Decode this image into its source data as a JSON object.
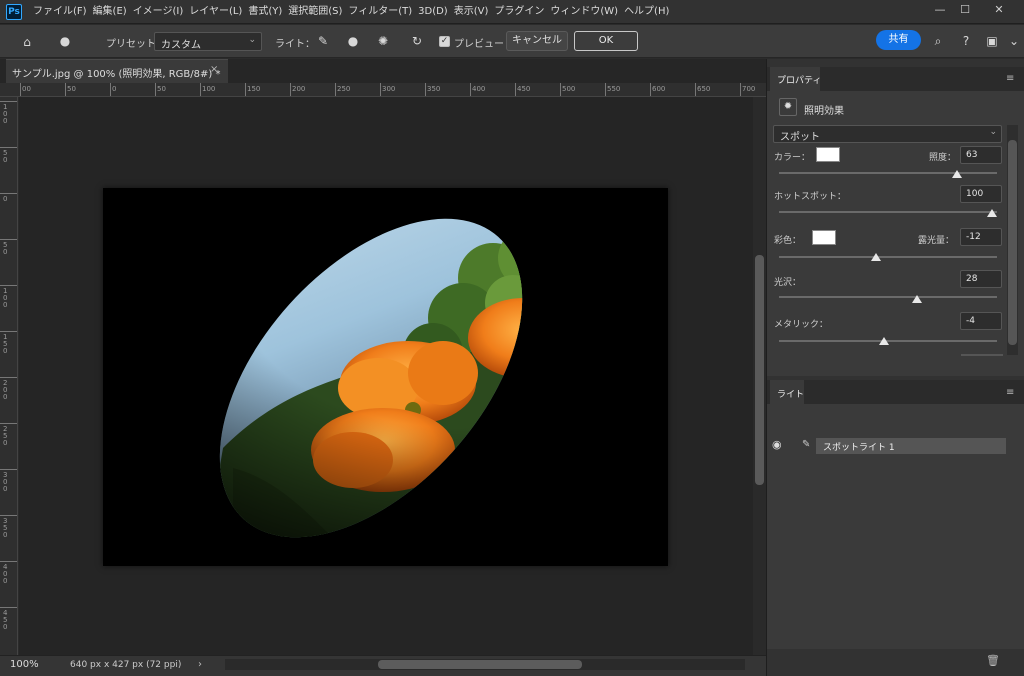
{
  "app": {
    "logo": "Ps"
  },
  "menu": {
    "items": [
      "ファイル(F)",
      "編集(E)",
      "イメージ(I)",
      "レイヤー(L)",
      "書式(Y)",
      "選択範囲(S)",
      "フィルター(T)",
      "3D(D)",
      "表示(V)",
      "プラグイン",
      "ウィンドウ(W)",
      "ヘルプ(H)"
    ]
  },
  "window_controls": {
    "minimize": "—",
    "maximize": "☐",
    "close": "✕"
  },
  "options": {
    "preset_label": "プリセット：",
    "preset_value": "カスタム",
    "light_label": "ライト：",
    "preview_label": "プレビュー",
    "preview_checked": true,
    "cancel_label": "キャンセル",
    "ok_label": "OK",
    "share_label": "共有",
    "icons": [
      "home-icon",
      "lightbulb-icon",
      "spotlight-icon",
      "point-light-icon",
      "infinite-light-icon",
      "reset-icon",
      "search-icon",
      "help-icon",
      "workspace-icon"
    ]
  },
  "document": {
    "tab_label": "サンプル.jpg @ 100% (照明効果, RGB/8#) *",
    "close": "×",
    "zoom": "100%",
    "size_info": "640 px x 427 px (72 ppi)",
    "status_arrow": "›"
  },
  "rulers": {
    "horizontal": [
      "00",
      "50",
      "0",
      "50",
      "100",
      "150",
      "200",
      "250",
      "300",
      "350",
      "400",
      "450",
      "500",
      "550",
      "600",
      "650",
      "700"
    ],
    "vertical": [
      "100",
      "50",
      "0",
      "50",
      "100",
      "150",
      "200",
      "250",
      "300",
      "350",
      "400",
      "450"
    ]
  },
  "properties": {
    "tab_label": "プロパティ",
    "effect_label": "照明効果",
    "light_type": "スポット",
    "color_label": "カラー：",
    "intensity_label": "照度：",
    "intensity_value": "63",
    "intensity_level": 0.83,
    "hotspot_label": "ホットスポット：",
    "hotspot_value": "100",
    "hotspot_level": 1.0,
    "colorize_label": "彩色：",
    "exposure_label": "露光量：",
    "exposure_value": "-12",
    "exposure_level": 0.44,
    "gloss_label": "光沢：",
    "gloss_value": "28",
    "gloss_level": 0.64,
    "metallic_label": "メタリック：",
    "metallic_value": "-4",
    "metallic_level": 0.48,
    "color_swatch": "#ffffff",
    "colorize_swatch": "#ffffff"
  },
  "lights": {
    "tab_label": "ライト",
    "items": [
      {
        "label": "スポットライト 1"
      }
    ]
  },
  "colors": {
    "accent": "#1473e6",
    "panel_bg": "#3a3a3a",
    "canvas_bg": "#252525"
  }
}
